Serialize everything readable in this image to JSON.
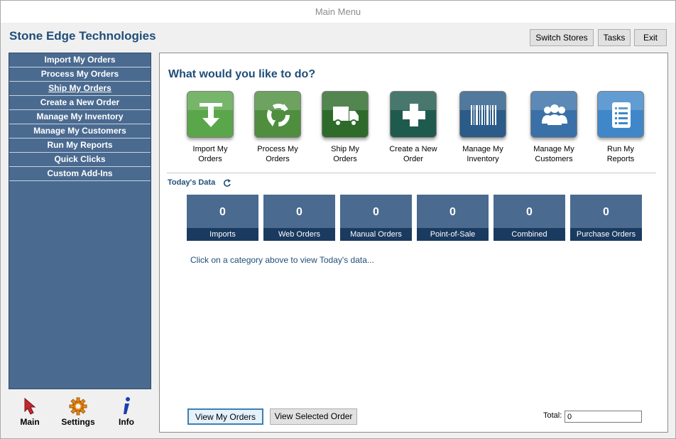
{
  "window": {
    "title": "Main Menu"
  },
  "header": {
    "brand": "Stone Edge Technologies",
    "buttons": [
      "Switch Stores",
      "Tasks",
      "Exit"
    ]
  },
  "sidebar": {
    "items": [
      {
        "label": "Import My Orders"
      },
      {
        "label": "Process My Orders"
      },
      {
        "label": "Ship My Orders"
      },
      {
        "label": "Create a New Order"
      },
      {
        "label": "Manage My Inventory"
      },
      {
        "label": "Manage My Customers"
      },
      {
        "label": "Run My Reports"
      },
      {
        "label": "Quick Clicks"
      },
      {
        "label": "Custom Add-Ins"
      }
    ]
  },
  "bottom_nav": {
    "items": [
      {
        "label": "Main",
        "icon": "arrow-cursor-icon"
      },
      {
        "label": "Settings",
        "icon": "gear-icon"
      },
      {
        "label": "Info",
        "icon": "info-icon"
      }
    ]
  },
  "main": {
    "heading": "What would you like to do?",
    "actions": [
      {
        "line1": "Import My",
        "line2": "Orders",
        "icon": "import-arrow-icon",
        "color": "#5aa64a"
      },
      {
        "line1": "Process My",
        "line2": "Orders",
        "icon": "recycle-icon",
        "color": "#4e8e3e"
      },
      {
        "line1": "Ship My",
        "line2": "Orders",
        "icon": "truck-icon",
        "color": "#2e6b2a"
      },
      {
        "line1": "Create a New",
        "line2": "Order",
        "icon": "plus-icon",
        "color": "#1f5a4e"
      },
      {
        "line1": "Manage My",
        "line2": "Inventory",
        "icon": "barcode-icon",
        "color": "#2b5b88"
      },
      {
        "line1": "Manage My",
        "line2": "Customers",
        "icon": "people-icon",
        "color": "#3a70a8"
      },
      {
        "line1": "Run My",
        "line2": "Reports",
        "icon": "report-list-icon",
        "color": "#3f87c9"
      }
    ],
    "today_label": "Today's Data",
    "stats": [
      {
        "value": "0",
        "label": "Imports"
      },
      {
        "value": "0",
        "label": "Web Orders"
      },
      {
        "value": "0",
        "label": "Manual Orders"
      },
      {
        "value": "0",
        "label": "Point-of-Sale"
      },
      {
        "value": "0",
        "label": "Combined"
      },
      {
        "value": "0",
        "label": "Purchase Orders"
      }
    ],
    "hint": "Click on a category above to view Today's data...",
    "view_orders_label": "View My Orders",
    "view_selected_label": "View Selected Order",
    "total_label": "Total:",
    "total_value": "0"
  }
}
